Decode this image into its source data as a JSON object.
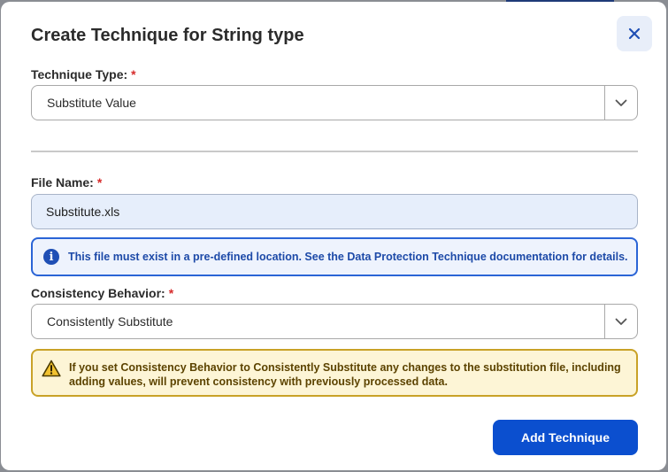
{
  "dialog": {
    "title": "Create Technique for String type",
    "close_icon": "close-icon"
  },
  "technique_type": {
    "label": "Technique Type:",
    "required_mark": "*",
    "value": "Substitute Value",
    "icon": "chevron-down-icon"
  },
  "file_name": {
    "label": "File Name:",
    "required_mark": "*",
    "value": "Substitute.xls"
  },
  "info_notice": {
    "icon": "info-icon",
    "text": "This file must exist in a pre-defined location. See the Data Protection Technique documentation for details."
  },
  "consistency_behavior": {
    "label": "Consistency Behavior:",
    "required_mark": "*",
    "value": "Consistently Substitute",
    "icon": "chevron-down-icon"
  },
  "warning_notice": {
    "icon": "warning-icon",
    "text": "If you set Consistency Behavior to Consistently Substitute any changes to the substitution file, including adding values, will prevent consistency with previously processed data."
  },
  "actions": {
    "add_label": "Add Technique"
  },
  "colors": {
    "primary": "#0b4fcf",
    "required": "#d62b2b",
    "info_border": "#2a64d6",
    "warning_border": "#c9a227",
    "warning_bg": "#fdf5d6"
  }
}
